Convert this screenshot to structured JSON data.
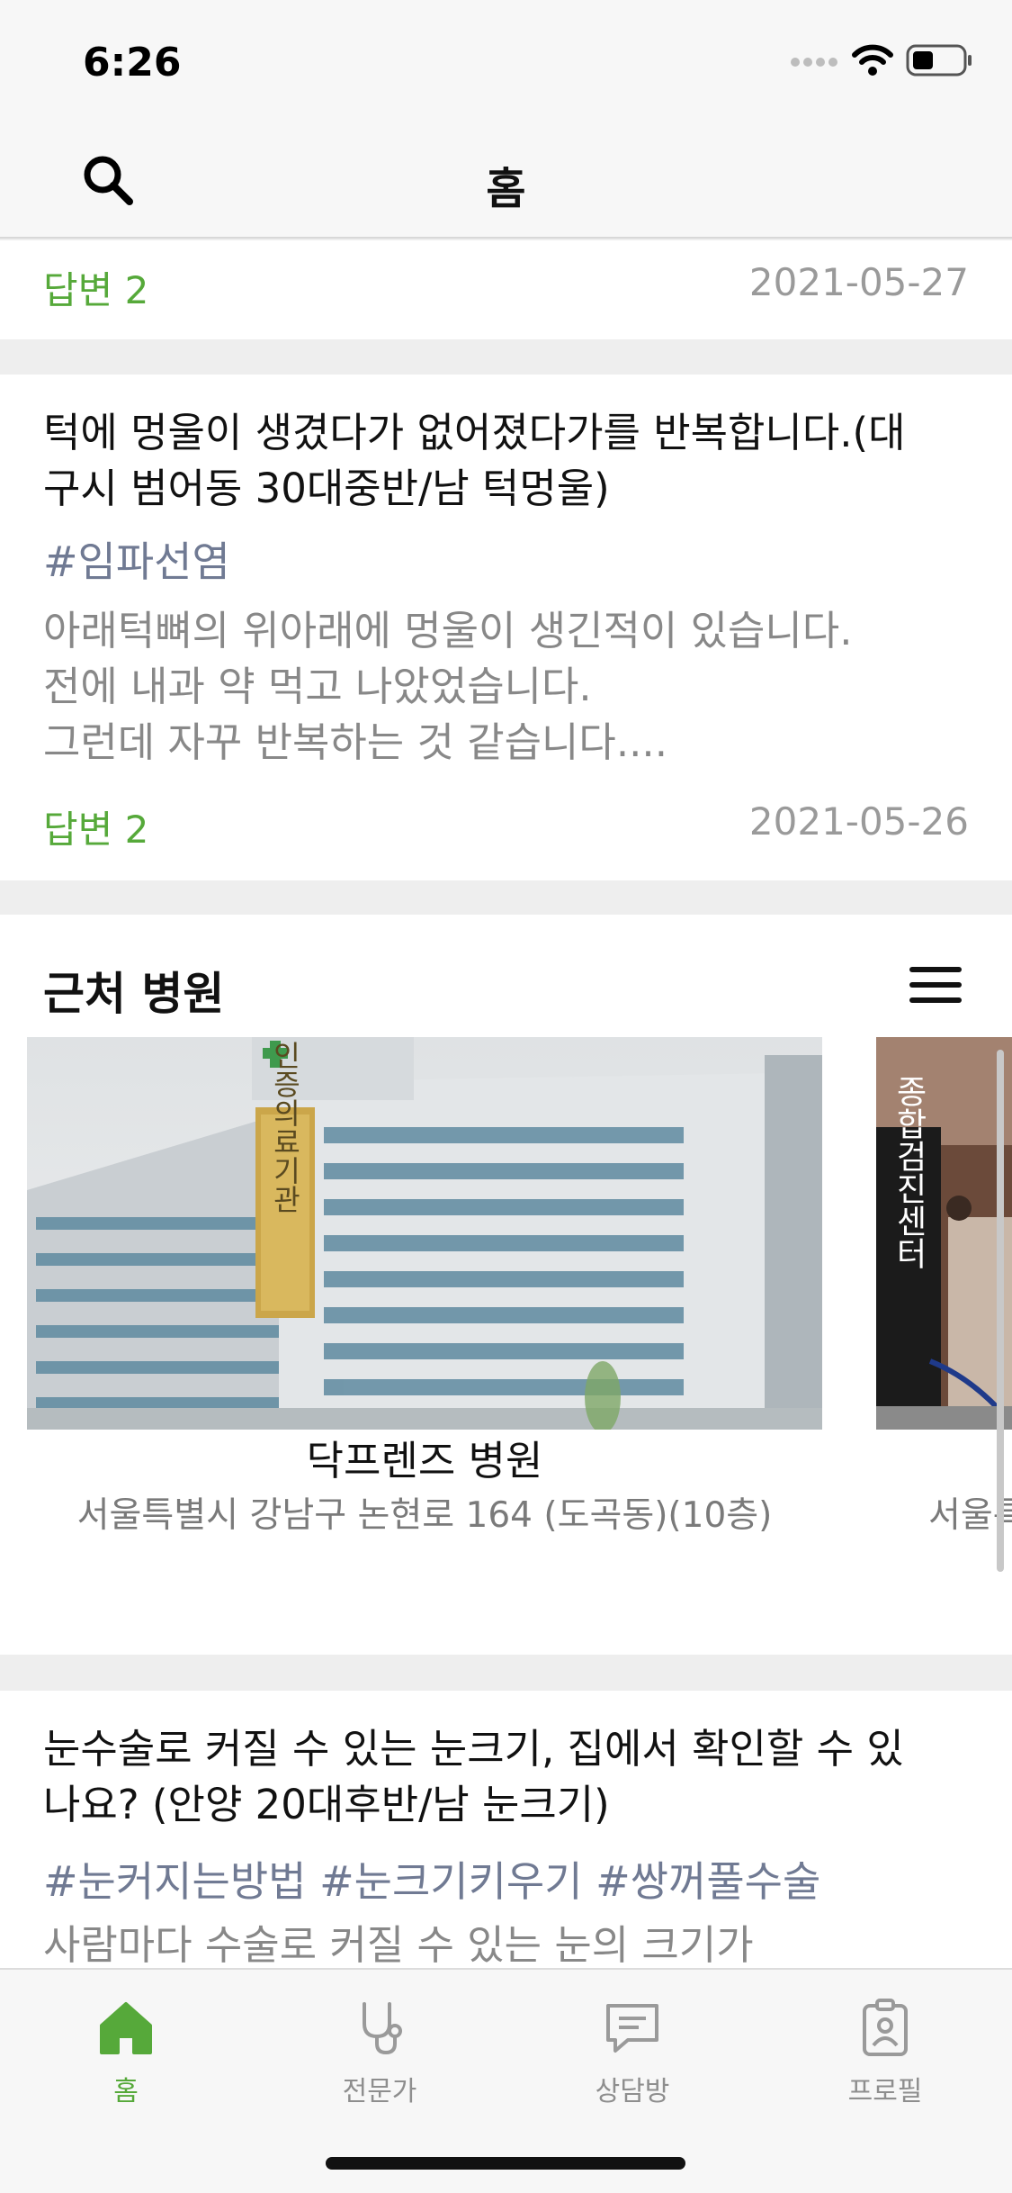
{
  "status_bar": {
    "time": "6:26"
  },
  "nav": {
    "title": "홈"
  },
  "questions": [
    {
      "answers": "답변 2",
      "date": "2021-05-27"
    },
    {
      "title": "턱에 멍울이 생겼다가 없어졌다가를 반복합니다.(대구시 범어동 30대중반/남 턱멍울)",
      "tags": "#임파선염",
      "body_lines": [
        "아래턱뼈의 위아래에 멍울이 생긴적이 있습니다.",
        "전에 내과 약 먹고 나았었습니다.",
        "그런데 자꾸 반복하는 것 같습니다...."
      ],
      "answers": "답변 2",
      "date": "2021-05-26"
    },
    {
      "title": "눈수술로 커질 수 있는 눈크기, 집에서 확인할 수 있나요? (안양 20대후반/남 눈크기)",
      "tags": "#눈커지는방법 #눈크기키우기 #쌍꺼풀수술",
      "body_lines": [
        "사람마다 수술로 커질 수 있는 눈의 크기가"
      ]
    }
  ],
  "nearby": {
    "title": "근처 병원",
    "hospitals": [
      {
        "name": "닥프렌즈 병원",
        "address": "서울특별시 강남구 논현로 164 (도곡동)(10층)",
        "sign_text": "인증의료기관"
      },
      {
        "name": "",
        "address": "서울특",
        "sign_text": "종합검진센터"
      }
    ]
  },
  "tabs": [
    {
      "label": "홈",
      "icon": "home-icon",
      "active": true
    },
    {
      "label": "전문가",
      "icon": "stethoscope-icon",
      "active": false
    },
    {
      "label": "상담방",
      "icon": "chat-icon",
      "active": false
    },
    {
      "label": "프로필",
      "icon": "profile-badge-icon",
      "active": false
    }
  ],
  "colors": {
    "accent": "#56a93a",
    "tag": "#707a93"
  }
}
